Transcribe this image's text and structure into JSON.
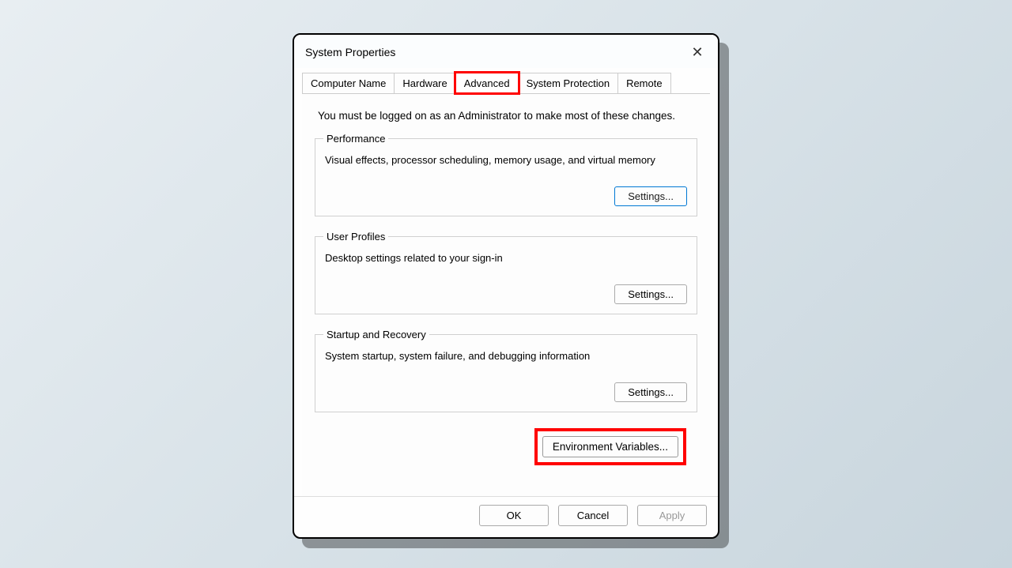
{
  "window": {
    "title": "System Properties"
  },
  "tabs": {
    "computer_name": "Computer Name",
    "hardware": "Hardware",
    "advanced": "Advanced",
    "system_protection": "System Protection",
    "remote": "Remote"
  },
  "intro": "You must be logged on as an Administrator to make most of these changes.",
  "groups": {
    "performance": {
      "legend": "Performance",
      "desc": "Visual effects, processor scheduling, memory usage, and virtual memory",
      "button": "Settings..."
    },
    "user_profiles": {
      "legend": "User Profiles",
      "desc": "Desktop settings related to your sign-in",
      "button": "Settings..."
    },
    "startup": {
      "legend": "Startup and Recovery",
      "desc": "System startup, system failure, and debugging information",
      "button": "Settings..."
    }
  },
  "env_button": "Environment Variables...",
  "footer": {
    "ok": "OK",
    "cancel": "Cancel",
    "apply": "Apply"
  }
}
